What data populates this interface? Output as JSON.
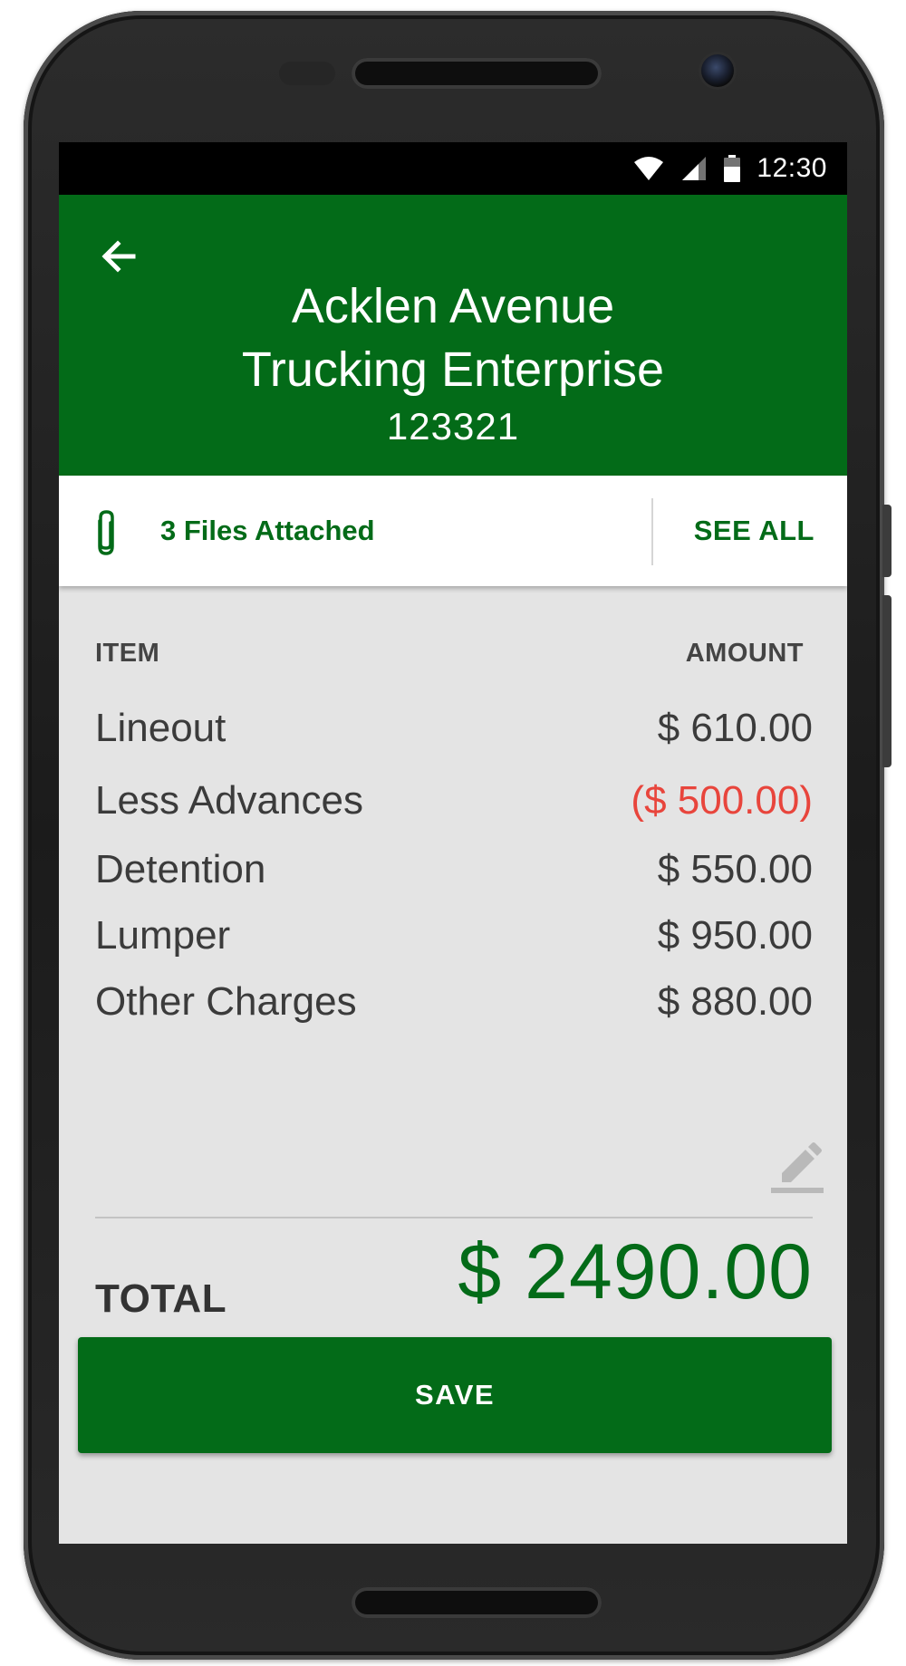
{
  "status_bar": {
    "time": "12:30",
    "icons": [
      "wifi-icon",
      "signal-icon",
      "battery-icon"
    ]
  },
  "app_bar": {
    "back_icon": "arrow-back-icon",
    "title_line1": "Acklen Avenue",
    "title_line2": "Trucking Enterprise",
    "subtitle": "123321",
    "background": "#036b18"
  },
  "attachments": {
    "icon": "paperclip-icon",
    "label": "3 Files Attached",
    "see_all": "SEE ALL"
  },
  "table": {
    "headers": {
      "item": "ITEM",
      "amount": "AMOUNT"
    },
    "rows": [
      {
        "item": "Lineout",
        "amount": "$ 610.00"
      },
      {
        "item": "Less Advances",
        "amount": "($ 500.00)",
        "negative": true
      },
      {
        "item": "Detention",
        "amount": "$ 550.00"
      },
      {
        "item": "Lumper",
        "amount": "$ 950.00"
      },
      {
        "item": "Other Charges",
        "amount": "$ 880.00"
      }
    ],
    "edit_icon": "pencil-edit-icon"
  },
  "total": {
    "label": "TOTAL",
    "value": "$ 2490.00"
  },
  "actions": {
    "save_label": "SAVE"
  },
  "colors": {
    "primary": "#036b18",
    "negative": "#e8453c",
    "surface": "#e4e4e4"
  }
}
